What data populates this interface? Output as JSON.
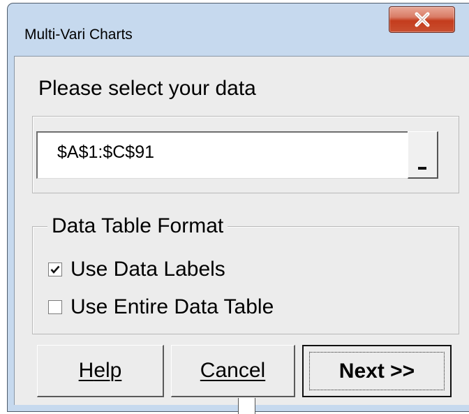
{
  "window": {
    "title": "Multi-Vari Charts",
    "close_icon": "close-x-icon",
    "colors": {
      "frame": "#c6d9ee",
      "client": "#ececec",
      "close_button": "#c43c1d"
    }
  },
  "data_selection": {
    "label": "Please select your data",
    "range_value": "$A$1:$C$91",
    "range_button_icon": "collapse-dialog-icon"
  },
  "format_group": {
    "legend": "Data Table Format",
    "options": [
      {
        "label": "Use Data Labels",
        "checked": true
      },
      {
        "label": "Use Entire Data Table",
        "checked": false
      }
    ]
  },
  "buttons": {
    "help": {
      "hotkey": "H",
      "rest": "elp"
    },
    "cancel": {
      "hotkey": "C",
      "rest": "ancel"
    },
    "next": "Next >>"
  }
}
